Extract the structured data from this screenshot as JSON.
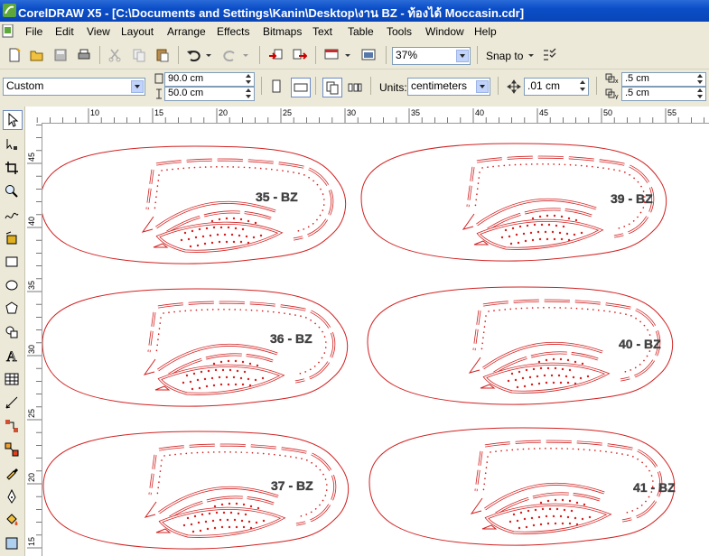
{
  "window": {
    "title": "CorelDRAW X5 - [C:\\Documents and Settings\\Kanin\\Desktop\\งาน BZ - ท้องได้ Moccasin.cdr]"
  },
  "menu": [
    "File",
    "Edit",
    "View",
    "Layout",
    "Arrange",
    "Effects",
    "Bitmaps",
    "Text",
    "Table",
    "Tools",
    "Window",
    "Help"
  ],
  "toolbar": {
    "zoom_value": "37%",
    "snap_to_label": "Snap to"
  },
  "property_bar": {
    "page_size": "Custom",
    "width": "90.0 cm",
    "height": "50.0 cm",
    "units_label": "Units:",
    "units_value": "centimeters",
    "nudge": ".01 cm",
    "dup_x": ".5 cm",
    "dup_y": ".5 cm"
  },
  "rulers": {
    "top_ticks": [
      "10",
      "15",
      "20",
      "25",
      "30",
      "35",
      "40",
      "45",
      "50",
      "55"
    ],
    "left_ticks": [
      "45",
      "40",
      "35",
      "30",
      "25",
      "20",
      "15"
    ]
  },
  "soles": [
    {
      "label": "35 - BZ"
    },
    {
      "label": "39 - BZ"
    },
    {
      "label": "36 - BZ"
    },
    {
      "label": "40 - BZ"
    },
    {
      "label": "37 - BZ"
    },
    {
      "label": "41 - BZ"
    }
  ],
  "colors": {
    "outline": "#d22020",
    "titlebar": "#0b4ec7"
  }
}
